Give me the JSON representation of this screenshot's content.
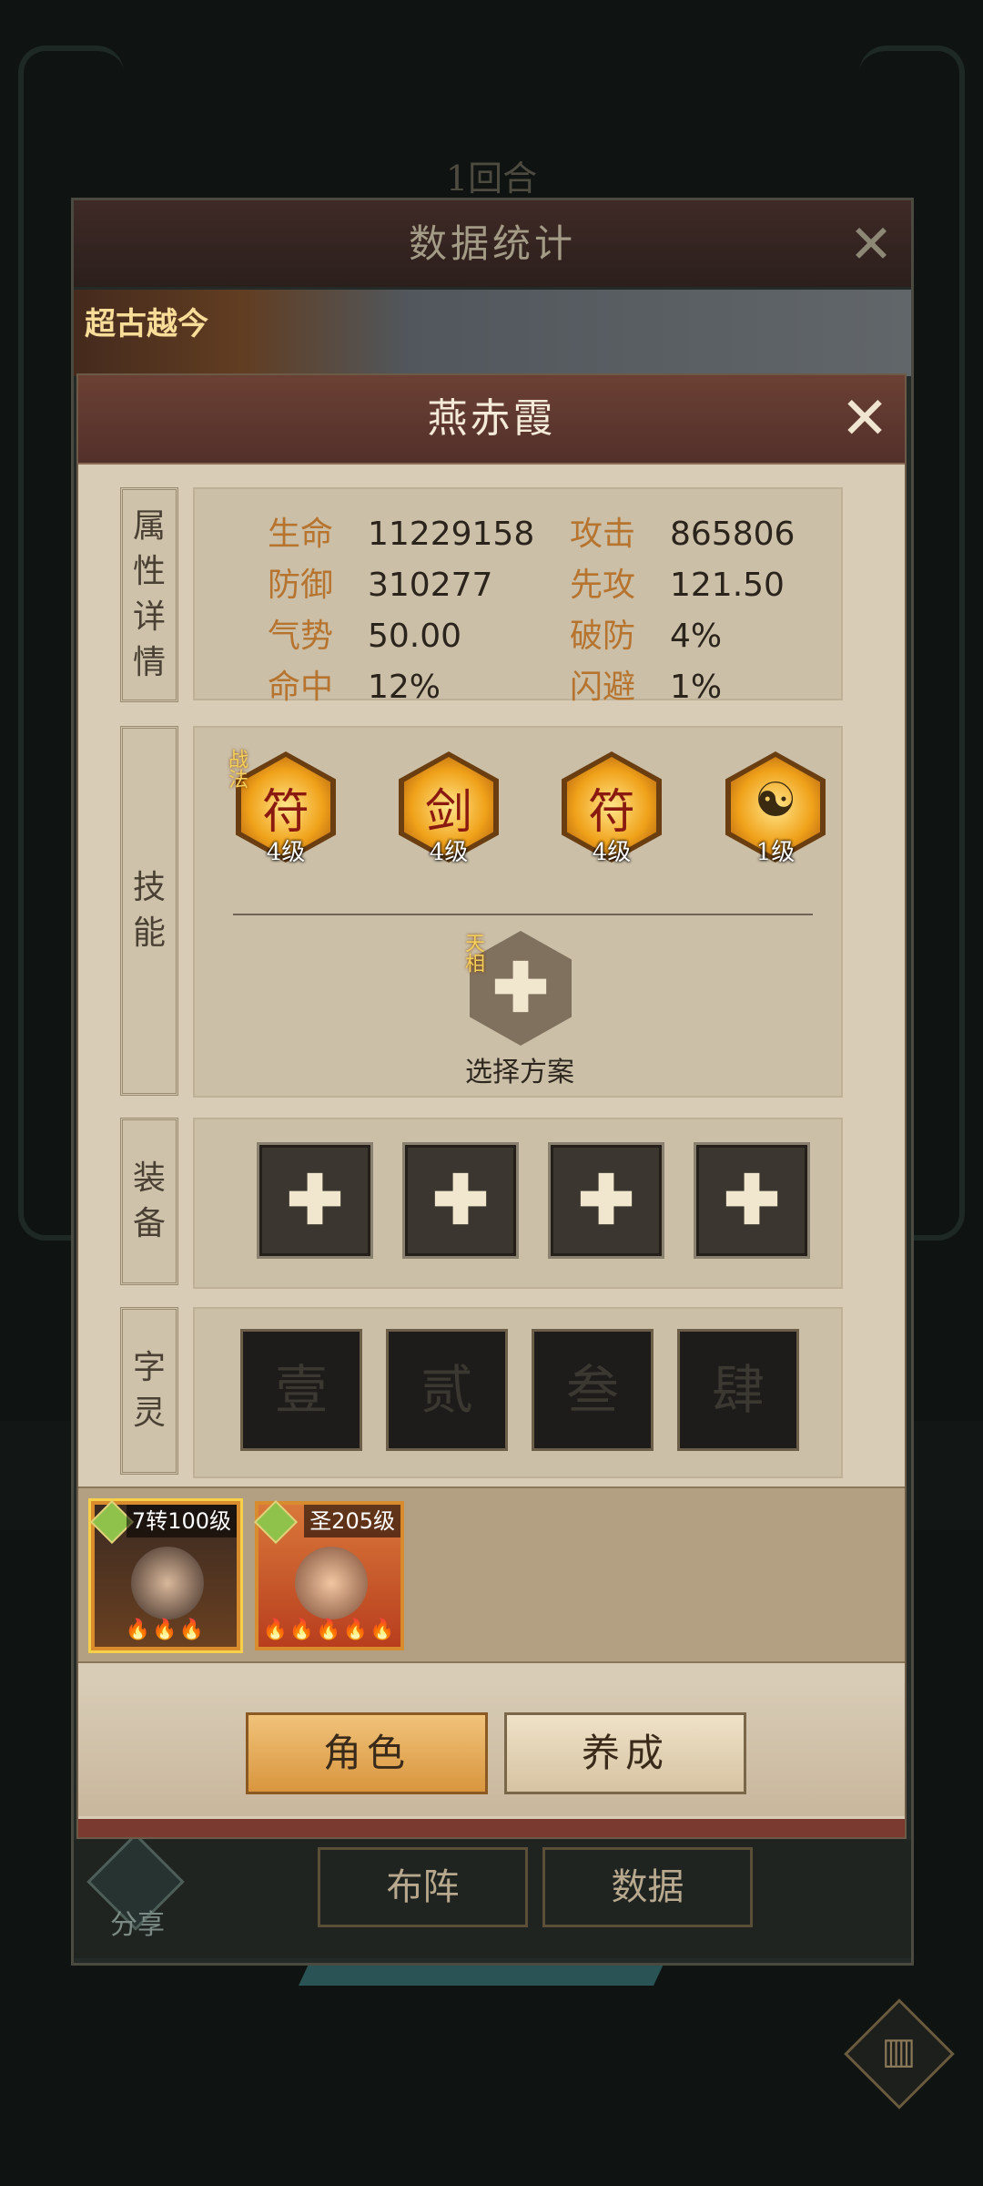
{
  "background": {
    "round_label": "1回合"
  },
  "outer_dialog": {
    "title": "数据统计",
    "banner_text": "超古越今",
    "share_label": "分享",
    "tabs": [
      "布阵",
      "数据"
    ]
  },
  "character": {
    "name": "燕赤霞"
  },
  "sections": {
    "attributes_tag": [
      "属",
      "性",
      "详",
      "情"
    ],
    "skills_tag": [
      "技",
      "能"
    ],
    "equipment_tag": [
      "装",
      "备"
    ],
    "spirit_tag": [
      "字",
      "灵"
    ]
  },
  "attributes": [
    {
      "label": "生命",
      "value": "11229158"
    },
    {
      "label": "攻击",
      "value": "865806"
    },
    {
      "label": "防御",
      "value": "310277"
    },
    {
      "label": "先攻",
      "value": "121.50"
    },
    {
      "label": "气势",
      "value": "50.00"
    },
    {
      "label": "破防",
      "value": "4%"
    },
    {
      "label": "命中",
      "value": "12%"
    },
    {
      "label": "闪避",
      "value": "1%"
    }
  ],
  "skills": [
    {
      "level": "4级",
      "badge": "战法",
      "icon": "talisman-icon",
      "glyph": "符"
    },
    {
      "level": "4级",
      "badge": "",
      "icon": "sword-icon",
      "glyph": "剑"
    },
    {
      "level": "4级",
      "badge": "",
      "icon": "talisman-pair-icon",
      "glyph": "符"
    },
    {
      "level": "1级",
      "badge": "",
      "icon": "yin-yang-icon",
      "glyph": "☯"
    }
  ],
  "tianxiang": {
    "badge": "天相",
    "label": "选择方案"
  },
  "spirit_slots": [
    "壹",
    "贰",
    "叁",
    "肆"
  ],
  "heroes": [
    {
      "level": "7转100级",
      "flames": "🔥🔥🔥",
      "selected": true
    },
    {
      "level": "圣205级",
      "flames": "🔥🔥🔥🔥🔥",
      "selected": false
    }
  ],
  "actions": {
    "role": "角色",
    "train": "养成"
  },
  "colors": {
    "accent_gold": "#e0a95a",
    "label_orange": "#b7742f",
    "panel_bg": "#d8ccb6"
  }
}
